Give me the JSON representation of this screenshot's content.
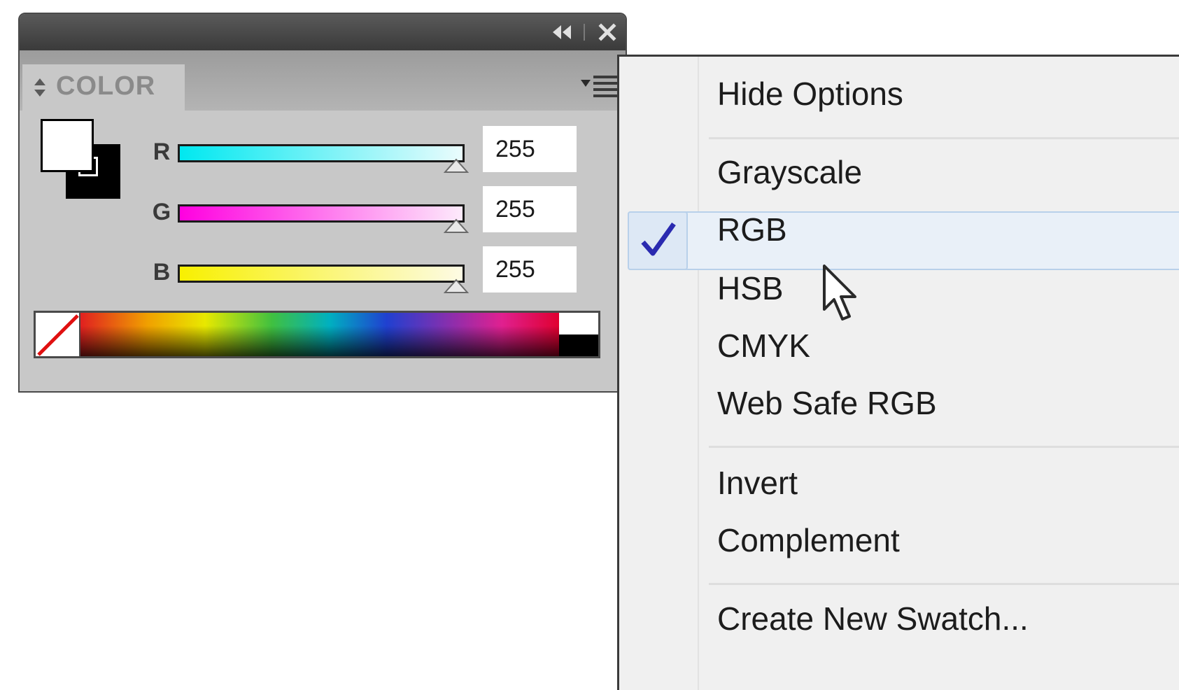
{
  "panel": {
    "tab_label": "COLOR",
    "channels": [
      {
        "label": "R",
        "value": "255",
        "level": 1.0
      },
      {
        "label": "G",
        "value": "255",
        "level": 1.0
      },
      {
        "label": "B",
        "value": "255",
        "level": 1.0
      }
    ],
    "fill_color": "#ffffff",
    "stroke_color": "#000000",
    "icons": [
      "collapse-icon",
      "close-icon",
      "tab-arrows-icon",
      "panel-menu-icon"
    ]
  },
  "menu": {
    "items": [
      {
        "label": "Hide Options"
      },
      {
        "label": "Grayscale"
      },
      {
        "label": "RGB",
        "checked": true
      },
      {
        "label": "HSB"
      },
      {
        "label": "CMYK"
      },
      {
        "label": "Web Safe RGB"
      },
      {
        "label": "Invert"
      },
      {
        "label": "Complement"
      },
      {
        "label": "Create New Swatch..."
      }
    ],
    "highlight_color": "#e9f0f8",
    "check_color": "#2a2ab0"
  }
}
